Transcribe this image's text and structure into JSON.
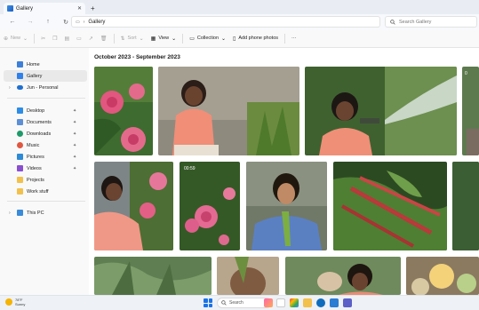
{
  "window": {
    "tab_title": "Gallery",
    "tab_close_glyph": "✕",
    "tab_add_glyph": "+"
  },
  "address": {
    "path_label": "Gallery",
    "search_placeholder": "Search Gallery"
  },
  "toolbar": {
    "new_label": "New",
    "sort_label": "Sort",
    "view_label": "View",
    "collection_label": "Collection",
    "add_phone_label": "Add phone photos",
    "more_glyph": "···"
  },
  "sidebar": {
    "home": "Home",
    "gallery": "Gallery",
    "onedrive": "Jun - Personal",
    "desktop": "Desktop",
    "documents": "Documents",
    "downloads": "Downloads",
    "music": "Music",
    "pictures": "Pictures",
    "videos": "Videos",
    "projects": "Projects",
    "work_stuff": "Work stuff",
    "this_pc": "This PC"
  },
  "content": {
    "section_title": "October 2023 - September 2023",
    "video_duration": "00:59"
  },
  "taskbar": {
    "temperature": "78°F",
    "condition": "Sunny",
    "search_label": "Search"
  },
  "colors": {
    "accent": "#1a73e8",
    "folder_yellow": "#f2c04c",
    "selected_bg": "#e9e9e9"
  },
  "icons": [
    "tab-gallery-icon",
    "back-icon",
    "forward-icon",
    "up-icon",
    "refresh-icon",
    "computer-icon",
    "search-icon",
    "home-icon",
    "gallery-icon",
    "onedrive-icon",
    "desktop-icon",
    "documents-icon",
    "downloads-icon",
    "music-icon",
    "pictures-icon",
    "videos-icon",
    "folder-icon",
    "pc-icon",
    "pin-icon",
    "windows-start-icon"
  ]
}
